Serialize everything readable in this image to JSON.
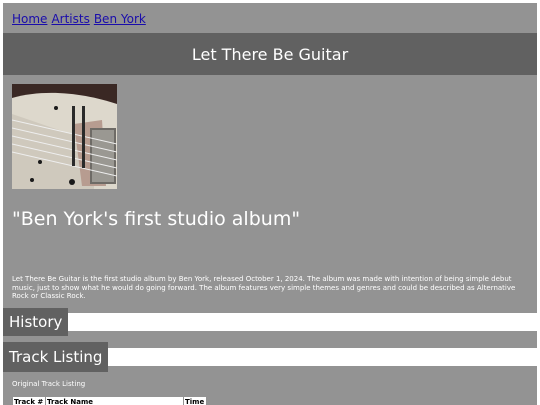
{
  "nav": {
    "links": [
      {
        "label": "Home"
      },
      {
        "label": "Artists"
      },
      {
        "label": "Ben York"
      }
    ]
  },
  "header": {
    "title": "Let There Be Guitar"
  },
  "album": {
    "tagline": "\"Ben York's first studio album\"",
    "description": "Let There Be Guitar is the first studio album by Ben York, released October 1, 2024. The album was made with intention of being simple debut music, just to show what he would do going forward. The album features very simple themes and genres and could be described as Alternative Rock or Classic Rock."
  },
  "sections": {
    "history": {
      "label": "History"
    },
    "tracks": {
      "label": "Track Listing"
    }
  },
  "track_listing": {
    "caption": "Original Track Listing",
    "columns": [
      "Track #",
      "Track Name",
      "Time"
    ]
  },
  "colors": {
    "page_bg": "#939393",
    "header_bg": "#616161",
    "link": "#1a0dab"
  }
}
